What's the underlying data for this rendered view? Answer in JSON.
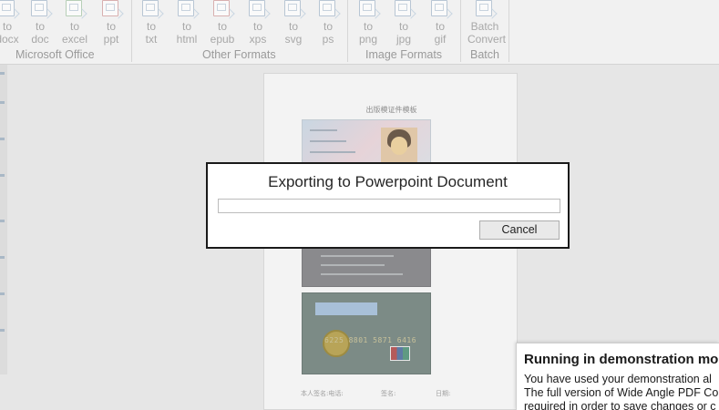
{
  "ribbon": {
    "groups": [
      {
        "label": "Microsoft Office",
        "buttons": [
          {
            "line1": "to",
            "line2": "docx"
          },
          {
            "line1": "to",
            "line2": "doc"
          },
          {
            "line1": "to",
            "line2": "excel"
          },
          {
            "line1": "to",
            "line2": "ppt"
          }
        ]
      },
      {
        "label": "Other Formats",
        "buttons": [
          {
            "line1": "to",
            "line2": "txt"
          },
          {
            "line1": "to",
            "line2": "html"
          },
          {
            "line1": "to",
            "line2": "epub"
          },
          {
            "line1": "to",
            "line2": "xps"
          },
          {
            "line1": "to",
            "line2": "svg"
          },
          {
            "line1": "to",
            "line2": "ps"
          }
        ]
      },
      {
        "label": "Image Formats",
        "buttons": [
          {
            "line1": "to",
            "line2": "png"
          },
          {
            "line1": "to",
            "line2": "jpg"
          },
          {
            "line1": "to",
            "line2": "gif"
          }
        ]
      },
      {
        "label": "Batch",
        "buttons": [
          {
            "line1": "Batch",
            "line2": "Convert"
          }
        ]
      }
    ]
  },
  "document": {
    "title": "出版模证件模板",
    "footer": [
      "本人签名:电话:",
      "签名:",
      "日期:"
    ],
    "bank_card_number": "6225 8801 5871 6416"
  },
  "dialog": {
    "title": "Exporting to Powerpoint Document",
    "progress": 0,
    "cancel_label": "Cancel"
  },
  "demo_popup": {
    "title": "Running in demonstration mo",
    "lines": [
      "You have used your demonstration al",
      "The full version of Wide Angle PDF Co",
      "required in order to save changes or c"
    ]
  }
}
